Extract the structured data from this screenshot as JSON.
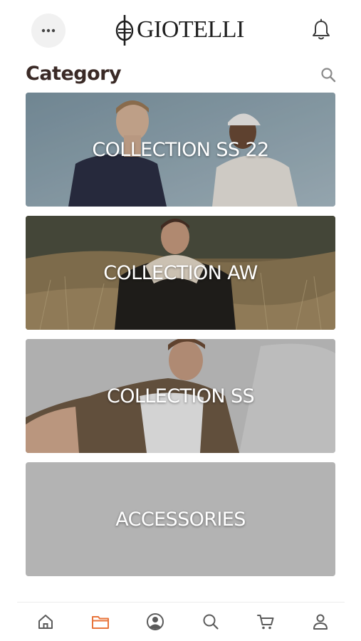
{
  "header": {
    "brand": "GIOTELLI",
    "menu_icon": "more-horizontal-icon",
    "notification_icon": "bell-icon"
  },
  "page": {
    "title": "Category",
    "search_icon": "search-icon"
  },
  "categories": [
    {
      "label": "COLLECTION SS 22"
    },
    {
      "label": "COLLECTION AW"
    },
    {
      "label": "COLLECTION SS"
    },
    {
      "label": "ACCESSORIES"
    }
  ],
  "bottom_nav": {
    "items": [
      {
        "icon": "home-icon",
        "active": false
      },
      {
        "icon": "folder-icon",
        "active": true
      },
      {
        "icon": "user-circle-icon",
        "active": false
      },
      {
        "icon": "search-icon",
        "active": false
      },
      {
        "icon": "cart-icon",
        "active": false
      },
      {
        "icon": "person-icon",
        "active": false
      }
    ],
    "active_color": "#e8743b",
    "inactive_color": "#5a5a5a"
  }
}
